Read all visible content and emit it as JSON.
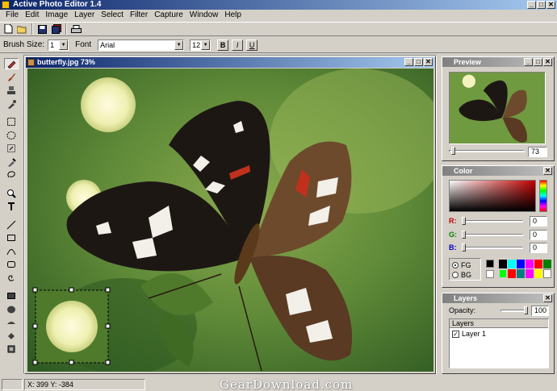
{
  "app": {
    "title": "Active Photo Editor 1.4"
  },
  "window_controls": {
    "minimize": "_",
    "maximize": "□",
    "close": "✕"
  },
  "menu": [
    "File",
    "Edit",
    "Image",
    "Layer",
    "Select",
    "Filter",
    "Capture",
    "Window",
    "Help"
  ],
  "toolbar": {
    "buttons": [
      "new-icon",
      "open-icon",
      "save-icon",
      "save-all-icon",
      "print-icon"
    ]
  },
  "options_bar": {
    "brush_size_label": "Brush Size:",
    "brush_size_value": "1",
    "font_label": "Font",
    "font_value": "Arial",
    "font_size_value": "12",
    "bold_label": "B",
    "italic_label": "I",
    "underline_label": "U"
  },
  "tools": [
    "pen-icon",
    "brush-icon",
    "stamp-icon",
    "dropper-icon",
    "rect-select-icon",
    "ellipse-select-icon",
    "magic-wand-icon",
    "eyedropper-icon",
    "lasso-icon",
    "zoom-icon",
    "text-icon",
    "line-icon",
    "rectangle-icon",
    "curve-icon",
    "rounded-rect-icon",
    "spiral-icon",
    "filled-rect-icon",
    "filled-ellipse-icon",
    "fill-icon",
    "gradient-icon",
    "stamp-tool-icon"
  ],
  "image_window": {
    "title": "butterfly.jpg 73%"
  },
  "preview_panel": {
    "title": "Preview",
    "zoom_value": "73",
    "zoom_level": 0.03
  },
  "color_panel": {
    "title": "Color",
    "r_label": "R:",
    "g_label": "G:",
    "b_label": "B:",
    "r_value": "0",
    "g_value": "0",
    "b_value": "0",
    "fg_label": "FG",
    "bg_label": "BG",
    "fg_selected": true,
    "swatches": [
      "#000000",
      "#00ffff",
      "#0000ff",
      "#ff00ff",
      "#ff0000",
      "#008000",
      "#ffffff",
      "#00ff00",
      "#008080",
      "#ff00ff",
      "#ffff00",
      "#000000"
    ],
    "fg_swatch": "#000000",
    "bg_swatch": "#ffffff"
  },
  "layers_panel": {
    "title": "Layers",
    "opacity_label": "Opacity:",
    "opacity_value": "100",
    "opacity_level": 1.0,
    "list_header": "Layers",
    "layers": [
      {
        "name": "Layer 1",
        "visible": true
      }
    ]
  },
  "status": {
    "coords": "X: 399 Y: -384"
  },
  "watermark": "GearDownload.com"
}
